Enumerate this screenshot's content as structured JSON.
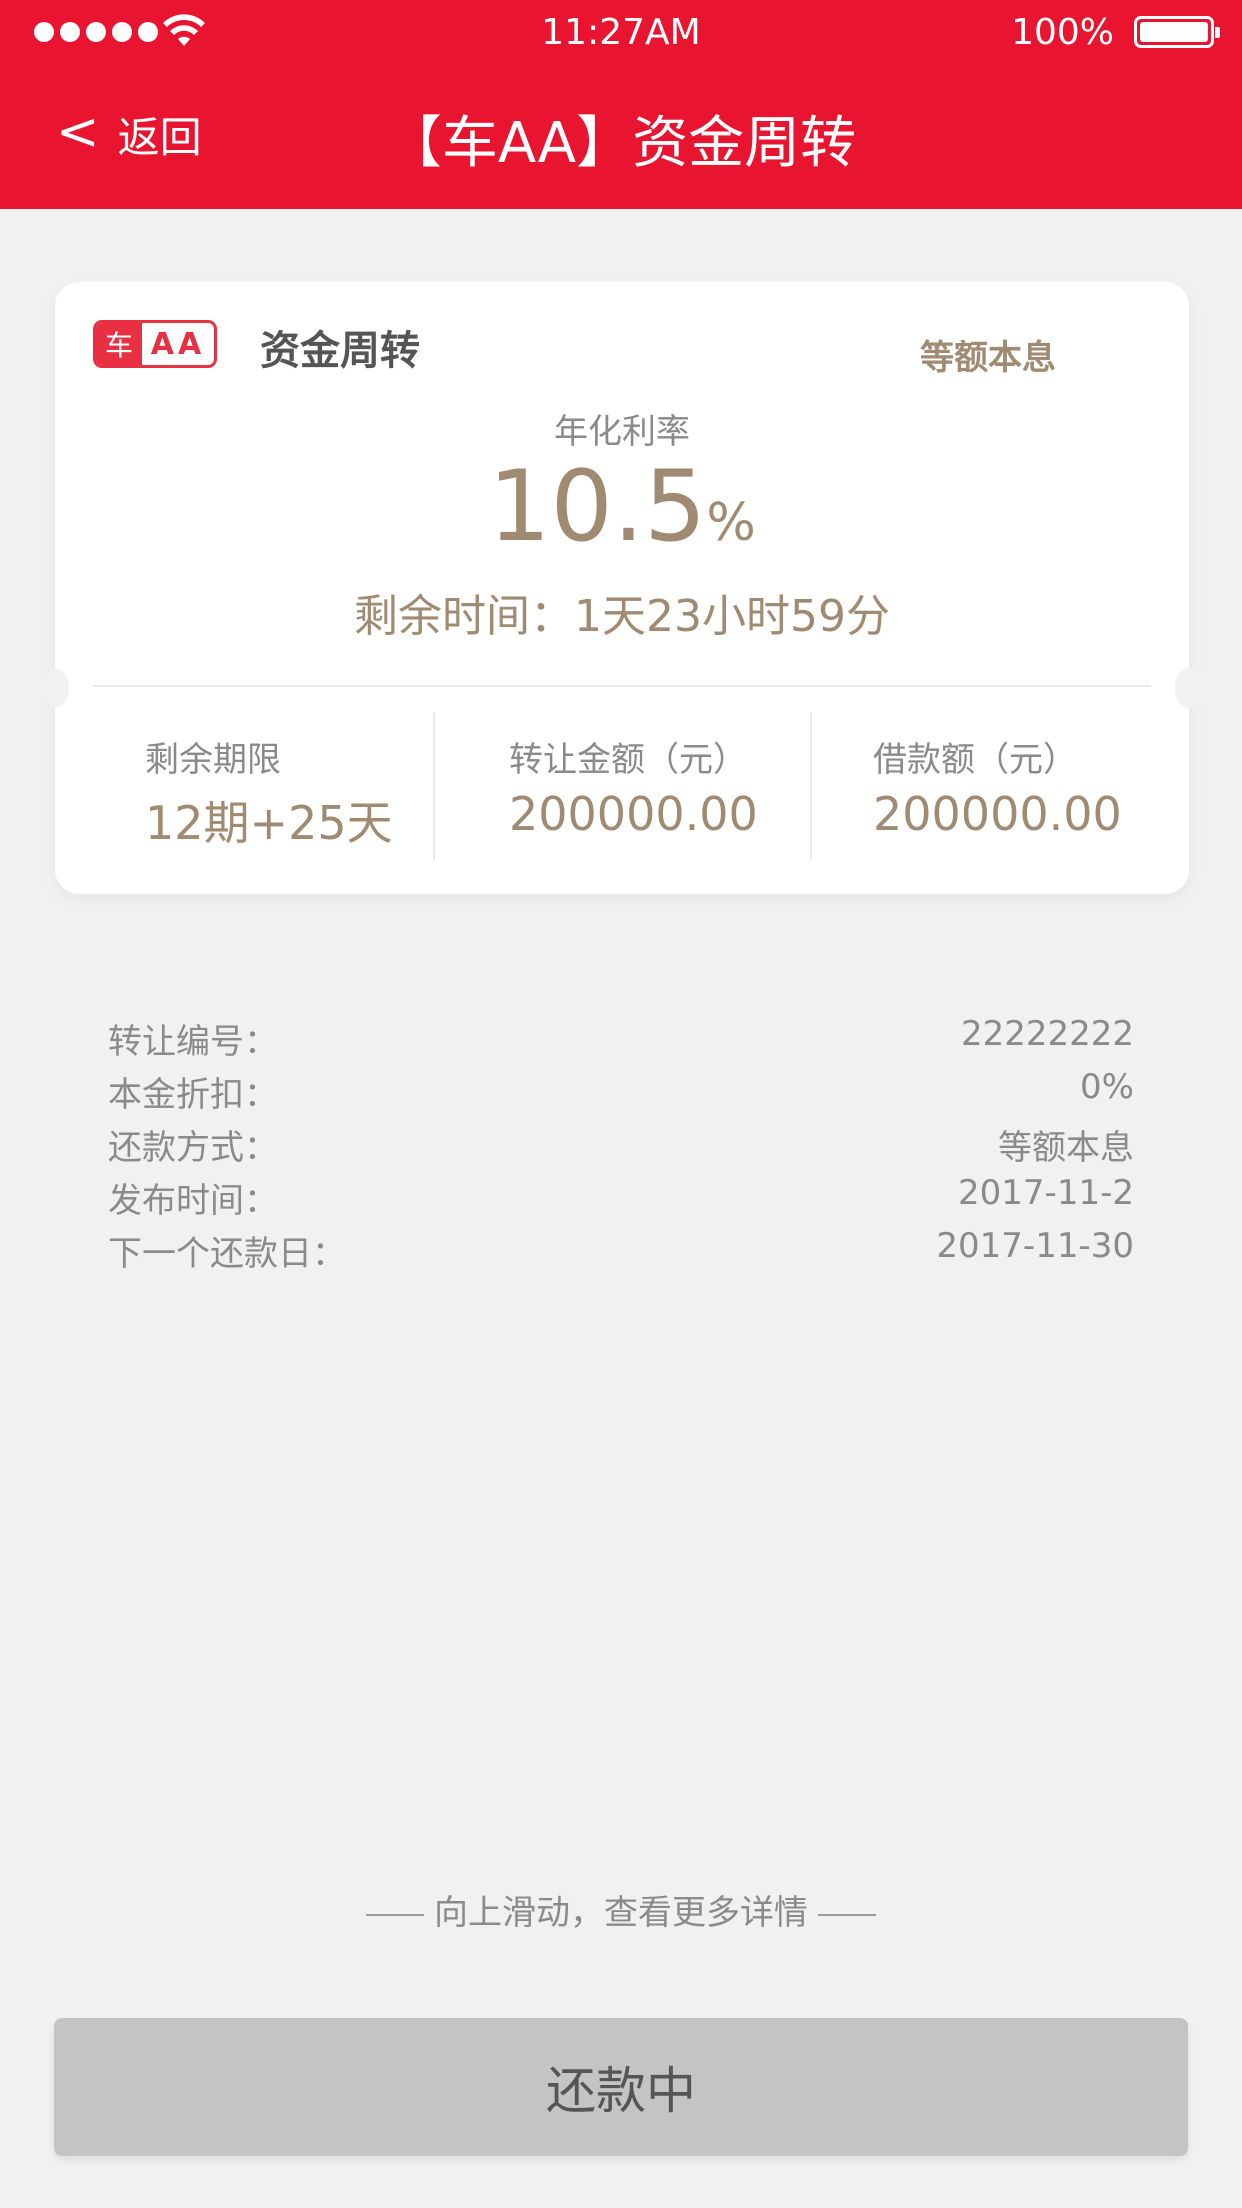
{
  "status_bar": {
    "time": "11:27AM",
    "battery": "100%"
  },
  "nav": {
    "back_label": "返回",
    "title": "【车AA】资金周转"
  },
  "card": {
    "logo_car": "车",
    "logo_aa": "AA",
    "product_name": "资金周转",
    "repay_method_tag": "等额本息",
    "rate_label": "年化利率",
    "rate_value": "10.5",
    "rate_unit": "%",
    "remaining_time": "剩余时间：1天23小时59分",
    "stats": [
      {
        "label": "剩余期限",
        "value": "12期+25天"
      },
      {
        "label": "转让金额（元）",
        "value": "200000.00"
      },
      {
        "label": "借款额（元）",
        "value": "200000.00"
      }
    ]
  },
  "details": [
    {
      "label": "转让编号：",
      "value": "22222222"
    },
    {
      "label": "本金折扣：",
      "value": "0%"
    },
    {
      "label": "还款方式：",
      "value": "等额本息"
    },
    {
      "label": "发布时间：",
      "value": "2017-11-2"
    },
    {
      "label": "下一个还款日：",
      "value": "2017-11-30"
    }
  ],
  "hint": "向上滑动，查看更多详情",
  "action_button": "还款中"
}
